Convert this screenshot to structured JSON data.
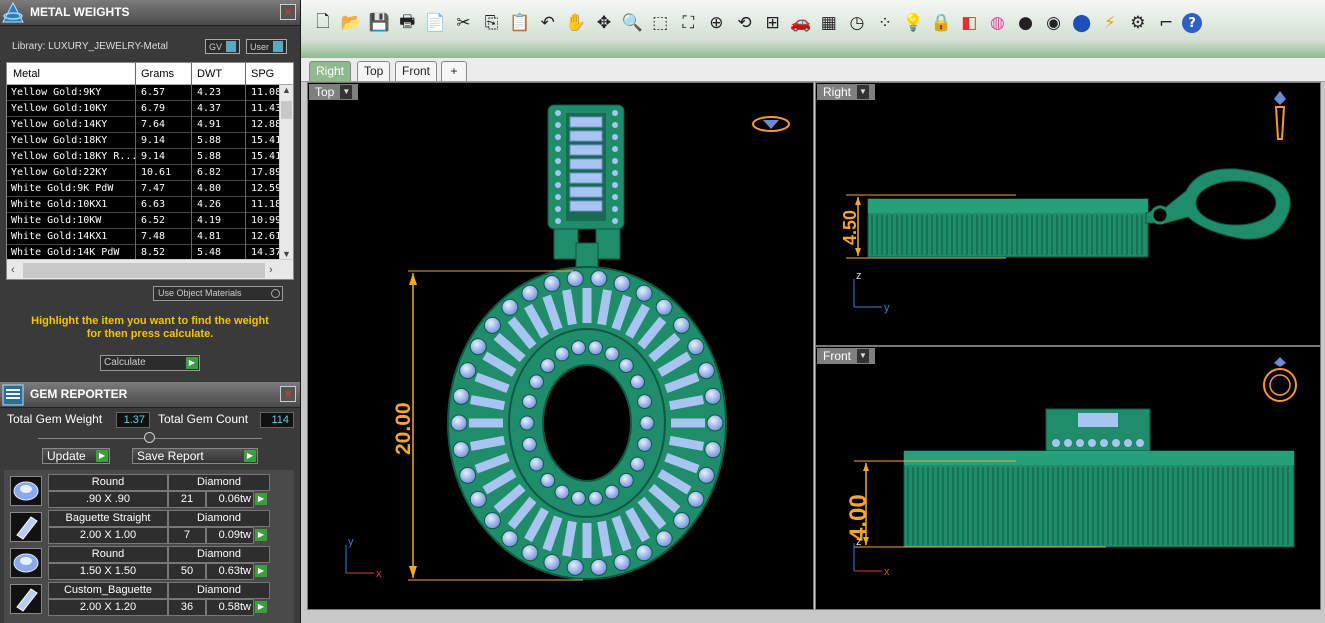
{
  "metal_weights": {
    "title": "METAL WEIGHTS",
    "library_label": "Library: LUXURY_JEWELRY-Metal",
    "gv_label": "GV",
    "user_label": "User",
    "columns": [
      "Metal",
      "Grams",
      "DWT",
      "SPG"
    ],
    "rows": [
      [
        "Yellow Gold:9KY",
        "6.57",
        "4.23",
        "11.08"
      ],
      [
        "Yellow Gold:10KY",
        "6.79",
        "4.37",
        "11.43"
      ],
      [
        "Yellow Gold:14KY",
        "7.64",
        "4.91",
        "12.88"
      ],
      [
        "Yellow Gold:18KY",
        "9.14",
        "5.88",
        "15.41"
      ],
      [
        "Yellow Gold:18KY R...",
        "9.14",
        "5.88",
        "15.41"
      ],
      [
        "Yellow Gold:22KY",
        "10.61",
        "6.82",
        "17.89"
      ],
      [
        "White Gold:9K PdW",
        "7.47",
        "4.80",
        "12.59"
      ],
      [
        "White Gold:10KX1",
        "6.63",
        "4.26",
        "11.18"
      ],
      [
        "White Gold:10KW",
        "6.52",
        "4.19",
        "10.99"
      ],
      [
        "White Gold:14KX1",
        "7.48",
        "4.81",
        "12.61"
      ],
      [
        "White Gold:14K PdW",
        "8.52",
        "5.48",
        "14.37"
      ]
    ],
    "use_object_materials": "Use Object Materials",
    "hint_line1": "Highlight the item you want to find the weight",
    "hint_line2": "for then press calculate.",
    "calculate_label": "Calculate"
  },
  "gem_reporter": {
    "title": "GEM REPORTER",
    "total_weight_label": "Total Gem Weight",
    "total_weight_value": "1.37",
    "total_count_label": "Total Gem Count",
    "total_count_value": "114",
    "update_label": "Update",
    "save_label": "Save Report",
    "gems": [
      {
        "shape": "Round",
        "size": ".90 X .90",
        "material": "Diamond",
        "count": "21",
        "weight": "0.06tw"
      },
      {
        "shape": "Baguette Straight",
        "size": "2.00 X 1.00",
        "material": "Diamond",
        "count": "7",
        "weight": "0.09tw"
      },
      {
        "shape": "Round",
        "size": "1.50 X 1.50",
        "material": "Diamond",
        "count": "50",
        "weight": "0.63tw"
      },
      {
        "shape": "Custom_Baguette",
        "size": "2.00 X 1.20",
        "material": "Diamond",
        "count": "36",
        "weight": "0.58tw"
      }
    ]
  },
  "toolbar": {
    "icons": [
      "new-icon",
      "open-icon",
      "save-icon",
      "print-icon",
      "export-icon",
      "cut-icon",
      "copy-icon",
      "paste-icon",
      "undo-icon",
      "pan-hand-icon",
      "move-icon",
      "zoom-in-icon",
      "zoom-window-icon",
      "zoom-extents-icon",
      "zoom-selected-icon",
      "rotate-view-icon",
      "four-viewports-icon",
      "car-icon",
      "grid-icon",
      "clock-icon",
      "points-icon",
      "bulb-icon",
      "lock-icon",
      "layers-icon",
      "color-wheel-icon",
      "sphere-gray-icon",
      "sphere-shaded-icon",
      "sphere-blue-icon",
      "flash-icon",
      "settings-gear-icon",
      "dimension-icon",
      "help-icon"
    ]
  },
  "tabs": [
    "Right",
    "Top",
    "Front",
    "+"
  ],
  "viewports": {
    "top": {
      "label": "Top",
      "dimension": "20.00",
      "axis_y": "y",
      "axis_x": "x"
    },
    "right": {
      "label": "Right",
      "dimension": "4.50",
      "axis_z": "z",
      "axis_y": "y"
    },
    "front": {
      "label": "Front",
      "dimension": "4.00",
      "axis_z": "z",
      "axis_x": "x"
    }
  },
  "colors": {
    "accent_gold": "#f4a72b",
    "model_green": "#1f8c6a",
    "gem_blue": "#a8c4f0",
    "panel_bg": "#3a3a3a",
    "hint_yellow": "#f5c400"
  }
}
